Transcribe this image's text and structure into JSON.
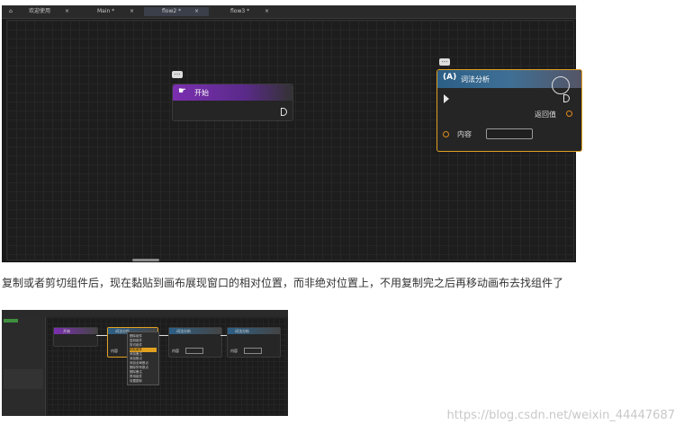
{
  "big": {
    "tabs": [
      {
        "label": "欢迎使用",
        "active": false
      },
      {
        "label": "Main *",
        "active": false
      },
      {
        "label": "flow2 *",
        "active": true
      },
      {
        "label": "flow3 *",
        "active": false
      }
    ],
    "nodes": {
      "start": {
        "title": "开始"
      },
      "lexer": {
        "title": "词法分析",
        "return_label": "返回值",
        "content_label": "内容"
      }
    }
  },
  "paragraph": "复制或者剪切组件后，现在黏贴到画布展现窗口的相对位置，而非绝对位置上，不用复制完之后再移动画布去找组件了",
  "small": {
    "nodes": [
      {
        "title": "开始"
      },
      {
        "title": "词法分析"
      },
      {
        "title": "词法分析"
      },
      {
        "title": "词法分析"
      }
    ],
    "content_label": "内容",
    "menu_items": [
      "删除组件",
      "复制组件",
      "剪切组件",
      "粘贴组件",
      "添加备注",
      "添加断点",
      "添加全局断点",
      "删除所有断点",
      "删除备注",
      "禁用组件",
      "设置图标"
    ],
    "selected_menu_index": 3
  },
  "watermark": "https://blog.csdn.net/weixin_44447687",
  "colors": {
    "start_head": "#7b2fb0",
    "lexer_head": "#2c5f86",
    "selection_border": "#e0a020"
  }
}
